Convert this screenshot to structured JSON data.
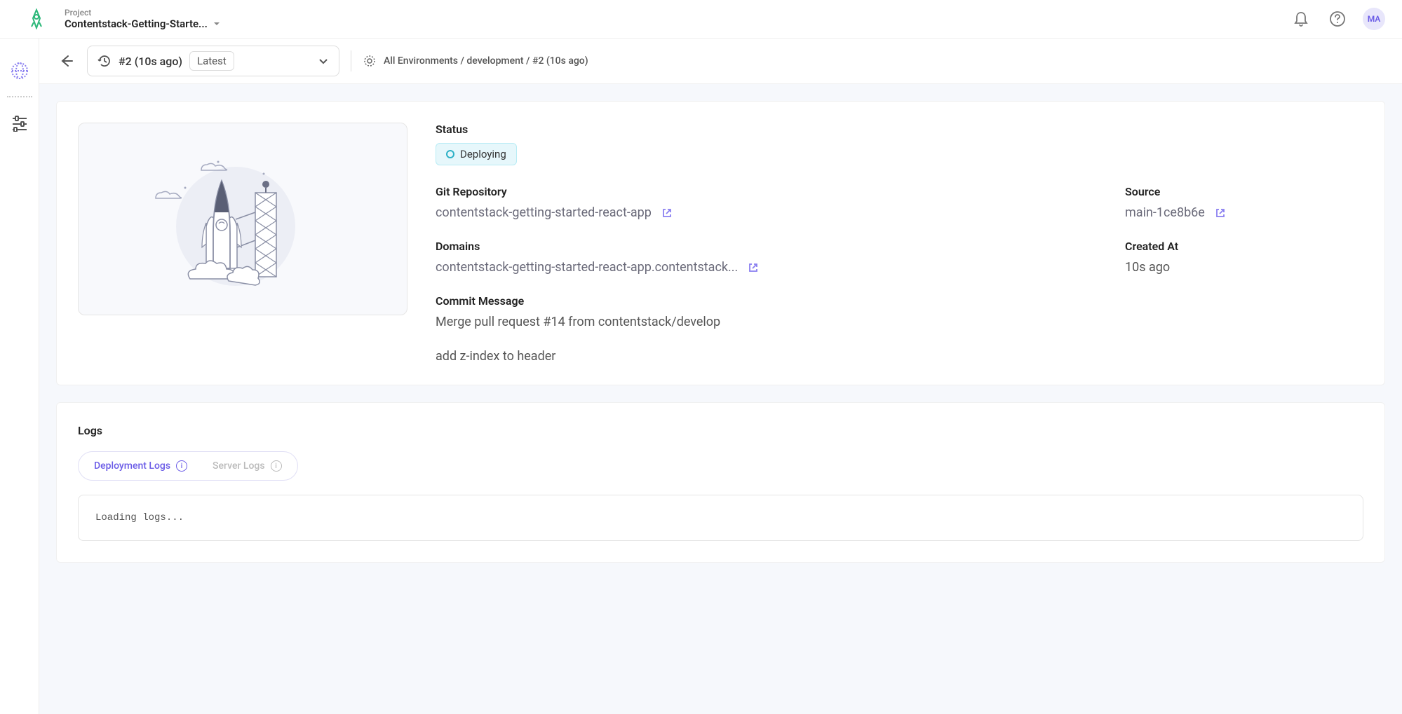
{
  "header": {
    "project_label": "Project",
    "project_name": "Contentstack-Getting-Starte...",
    "avatar_initials": "MA"
  },
  "subheader": {
    "deploy_name": "#2 (10s ago)",
    "latest_badge": "Latest",
    "breadcrumb": "All Environments / development / #2 (10s ago)"
  },
  "details": {
    "status_label": "Status",
    "status_value": "Deploying",
    "git_repo_label": "Git Repository",
    "git_repo_value": "contentstack-getting-started-react-app",
    "source_label": "Source",
    "source_value": "main-1ce8b6e",
    "domains_label": "Domains",
    "domains_value": "contentstack-getting-started-react-app.contentstack...",
    "created_at_label": "Created At",
    "created_at_value": "10s ago",
    "commit_label": "Commit Message",
    "commit_value": "Merge pull request #14 from contentstack/develop",
    "commit_extra": "add z-index to header"
  },
  "logs": {
    "title": "Logs",
    "tab_deployment": "Deployment Logs",
    "tab_server": "Server Logs",
    "output": "Loading logs..."
  }
}
